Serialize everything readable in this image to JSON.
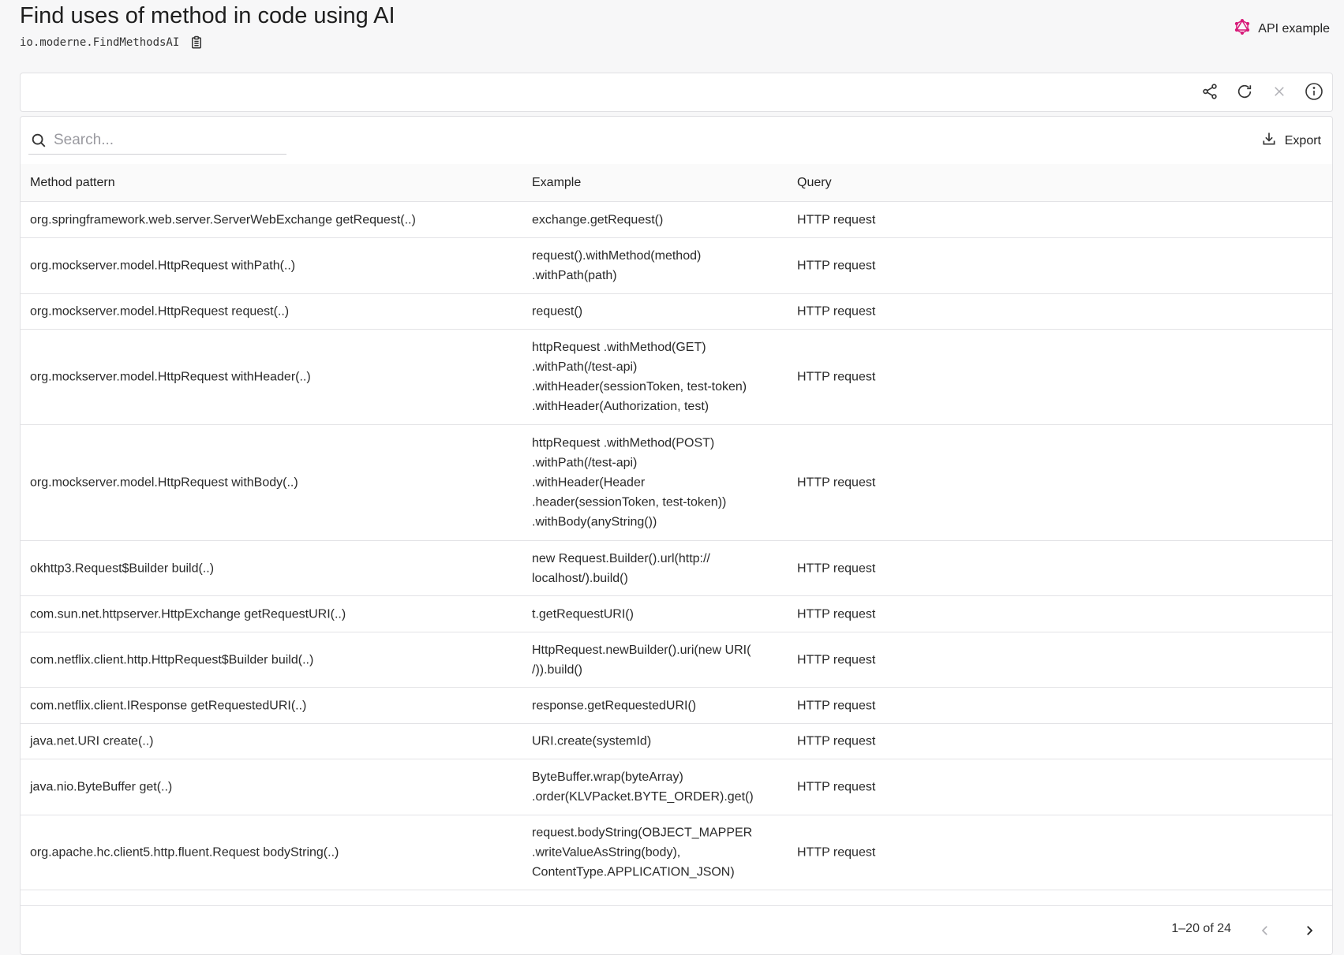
{
  "header": {
    "title": "Find uses of method in code using AI",
    "recipe_id": "io.moderne.FindMethodsAI",
    "api_example_label": "API example"
  },
  "toolbar": {
    "icons": [
      "share-icon",
      "refresh-icon",
      "close-icon",
      "info-icon"
    ]
  },
  "table": {
    "search": {
      "placeholder": "Search...",
      "value": ""
    },
    "export_label": "Export",
    "columns": [
      "Method pattern",
      "Example",
      "Query"
    ],
    "rows": [
      {
        "method": "org.springframework.web.server.ServerWebExchange getRequest(..)",
        "example": "exchange.getRequest()",
        "query": "HTTP request"
      },
      {
        "method": "org.mockserver.model.HttpRequest withPath(..)",
        "example": "request().withMethod(method)\n.withPath(path)",
        "query": "HTTP request"
      },
      {
        "method": "org.mockserver.model.HttpRequest request(..)",
        "example": "request()",
        "query": "HTTP request"
      },
      {
        "method": "org.mockserver.model.HttpRequest withHeader(..)",
        "example": "httpRequest .withMethod(GET)\n.withPath(/test-api)\n.withHeader(sessionToken, test-token)\n.withHeader(Authorization, test)",
        "query": "HTTP request"
      },
      {
        "method": "org.mockserver.model.HttpRequest withBody(..)",
        "example": "httpRequest .withMethod(POST)\n.withPath(/test-api)\n.withHeader(Header\n.header(sessionToken, test-token))\n.withBody(anyString())",
        "query": "HTTP request"
      },
      {
        "method": "okhttp3.Request$Builder build(..)",
        "example": "new Request.Builder().url(http://\nlocalhost/).build()",
        "query": "HTTP request"
      },
      {
        "method": "com.sun.net.httpserver.HttpExchange getRequestURI(..)",
        "example": "t.getRequestURI()",
        "query": "HTTP request"
      },
      {
        "method": "com.netflix.client.http.HttpRequest$Builder build(..)",
        "example": "HttpRequest.newBuilder().uri(new URI(\n/)).build()",
        "query": "HTTP request"
      },
      {
        "method": "com.netflix.client.IResponse getRequestedURI(..)",
        "example": "response.getRequestedURI()",
        "query": "HTTP request"
      },
      {
        "method": "java.net.URI create(..)",
        "example": "URI.create(systemId)",
        "query": "HTTP request"
      },
      {
        "method": "java.nio.ByteBuffer get(..)",
        "example": "ByteBuffer.wrap(byteArray)\n.order(KLVPacket.BYTE_ORDER).get()",
        "query": "HTTP request"
      },
      {
        "method": "org.apache.hc.client5.http.fluent.Request bodyString(..)",
        "example": "request.bodyString(OBJECT_MAPPER\n.writeValueAsString(body),\nContentType.APPLICATION_JSON)",
        "query": "HTTP request"
      }
    ]
  },
  "pagination": {
    "range_text": "1–20 of 24"
  },
  "colors": {
    "api_icon": "#d81b7a",
    "border": "#e0e0e3",
    "background": "#f7f7f8"
  }
}
